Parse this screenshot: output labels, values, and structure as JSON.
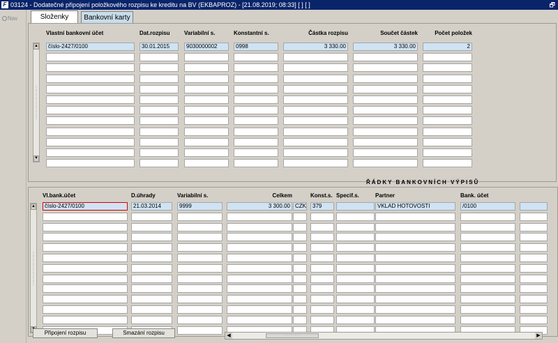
{
  "window": {
    "title": "03124 - Dodatečné připojení položkového rozpisu ke kreditu na BV (EKBAPROZ) - [21.08.2019; 08:33]  [ ]  [ ]",
    "app_icon_glyph": "F",
    "restore_glyph": "🗗"
  },
  "nav": {
    "label": "Nav"
  },
  "tabs": [
    {
      "label": "Složenky",
      "active": true
    },
    {
      "label": "Bankovní karty",
      "active": false
    }
  ],
  "top_table": {
    "headers": [
      "Vlastní bankovní účet",
      "Dat.rozpisu",
      "Variabilní s.",
      "Konstantní s.",
      "Částka rozpisu",
      "Součet částek",
      "Počet položek"
    ],
    "rows": [
      [
        "číslo-2427/0100",
        "30.01.2015",
        "9030000002",
        "0998",
        "3 330.00",
        "3 330.00",
        "2"
      ]
    ],
    "row_count": 12
  },
  "bottom_section": {
    "title": "ŘÁDKY BANKOVNÍCH VÝPISŮ"
  },
  "bottom_table": {
    "headers": [
      "Vl.bank.účet",
      "D.úhrady",
      "Variabilní s.",
      "Celkem",
      "",
      "Konst.s.",
      "Specif.s.",
      "Partner",
      "Bank. účet"
    ],
    "rows": [
      [
        "číslo-2427/0100",
        "21.03.2014",
        "9999",
        "3 300.00",
        "CZK",
        "379",
        "",
        "VKLAD HOTOVOSTI",
        "/0100"
      ]
    ],
    "row_count": 13
  },
  "buttons": {
    "attach": "Připojení rozpisu",
    "delete": "Smazání rozpisu"
  },
  "icons": {
    "scroll_up": "▲",
    "scroll_down": "▼",
    "scroll_left": "◀",
    "scroll_right": "▶",
    "grip": "⋮"
  }
}
